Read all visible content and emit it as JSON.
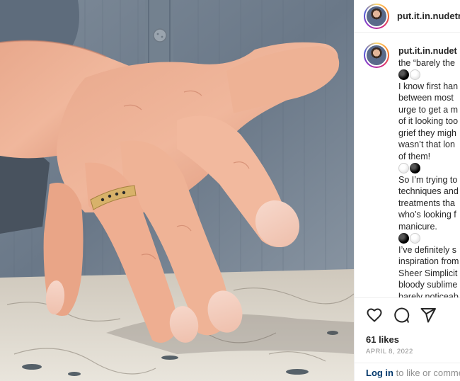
{
  "post": {
    "username": "put.it.in.nudetr",
    "photo_alt": "hand",
    "caption": {
      "username": "put.it.in.nudet",
      "lines": [
        "the “barely the",
        "",
        "I know first han",
        "between most",
        "urge to get a m",
        "of it looking too",
        "grief they migh",
        "wasn’t that lon",
        "of them!",
        "",
        "So I’m trying to",
        "techniques and",
        "treatments tha",
        "who’s looking f",
        "manicure.",
        "",
        "I’ve definitely s",
        "inspiration from",
        "Sheer Simplicit",
        "bloody sublime",
        "barely noticeab"
      ]
    },
    "likes": "61 likes",
    "date": "APRIL 8, 2022",
    "login_link": "Log in",
    "login_rest": " to like or comme"
  },
  "icons": {
    "like": "heart-icon",
    "comment": "comment-icon",
    "share": "send-icon"
  },
  "colors": {
    "link": "#00376b",
    "muted": "#8e8e8e",
    "text": "#262626"
  }
}
